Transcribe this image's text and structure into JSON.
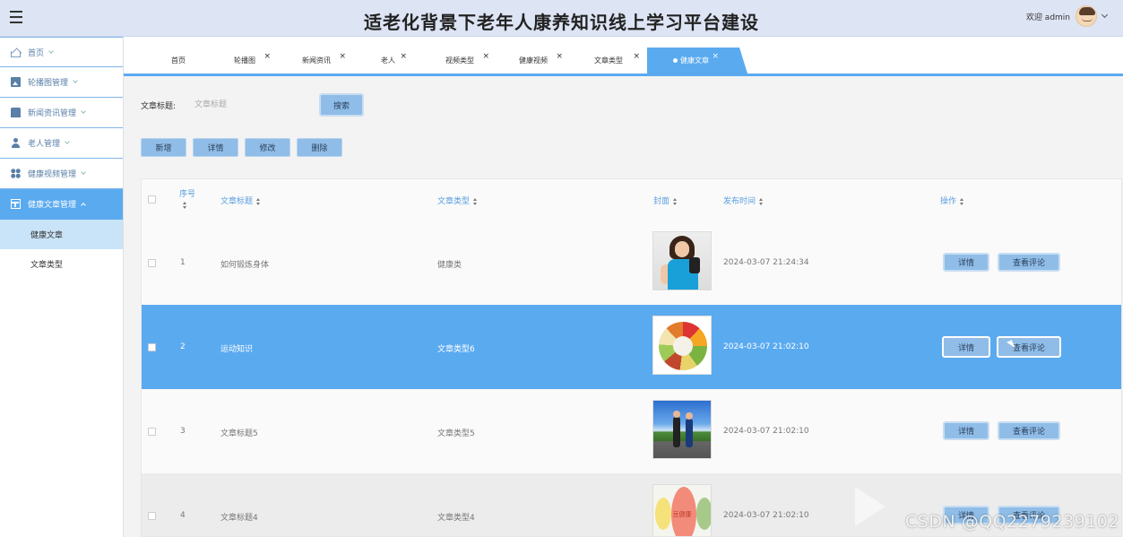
{
  "header": {
    "title": "适老化背景下老年人康养知识线上学习平台建设",
    "user_greeting": "欢迎 admin"
  },
  "sidebar": {
    "items": [
      {
        "label": "首页",
        "icon": "home-icon"
      },
      {
        "label": "轮播图管理",
        "icon": "picture-icon"
      },
      {
        "label": "新闻资讯管理",
        "icon": "shop-icon"
      },
      {
        "label": "老人管理",
        "icon": "user-icon"
      },
      {
        "label": "健康视频管理",
        "icon": "grid-icon"
      },
      {
        "label": "健康文章管理",
        "icon": "layout-icon",
        "active": true
      }
    ],
    "sub_items": [
      {
        "label": "健康文章",
        "active": true
      },
      {
        "label": "文章类型"
      }
    ]
  },
  "tabs": [
    {
      "label": "首页",
      "closable": false
    },
    {
      "label": "轮播图",
      "closable": true
    },
    {
      "label": "新闻资讯",
      "closable": true
    },
    {
      "label": "老人",
      "closable": true
    },
    {
      "label": "视频类型",
      "closable": true
    },
    {
      "label": "健康视频",
      "closable": true
    },
    {
      "label": "文章类型",
      "closable": true
    },
    {
      "label": "健康文章",
      "closable": true,
      "active": true
    }
  ],
  "search": {
    "label": "文章标题:",
    "placeholder": "文章标题",
    "button": "搜索"
  },
  "actions": {
    "add": "新增",
    "detail": "详情",
    "edit": "修改",
    "delete": "删除"
  },
  "table": {
    "headers": {
      "index": "序号",
      "title": "文章标题",
      "type": "文章类型",
      "cover": "封面",
      "time": "发布时间",
      "ops": "操作"
    },
    "rows": [
      {
        "index": "1",
        "title": "如何锻炼身体",
        "type": "健康类",
        "time": "2024-03-07 21:24:34",
        "cover": "fitness-woman-image"
      },
      {
        "index": "2",
        "title": "运动知识",
        "type": "文章类型6",
        "time": "2024-03-07 21:02:10",
        "cover": "food-plate-image",
        "selected": true
      },
      {
        "index": "3",
        "title": "文章标题5",
        "type": "文章类型5",
        "time": "2024-03-07 21:02:10",
        "cover": "running-couple-image"
      },
      {
        "index": "4",
        "title": "文章标题4",
        "type": "文章类型4",
        "time": "2024-03-07 21:02:10",
        "cover": "health-chart-image"
      }
    ],
    "row_buttons": {
      "detail": "详情",
      "comments": "查看评论"
    },
    "thumb_text": "豆健康"
  },
  "watermark": "CSDN @QQ2279239102",
  "colors": {
    "accent": "#5aaaf0",
    "header_bg": "#dde4f4",
    "button_bg": "#8fbde8"
  }
}
